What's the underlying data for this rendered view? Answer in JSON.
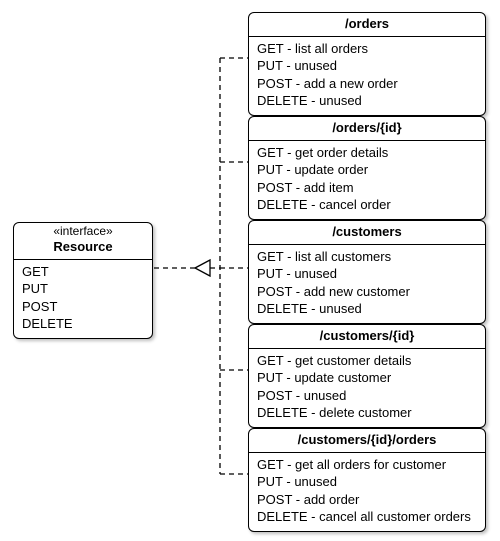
{
  "interface": {
    "stereotype": "«interface»",
    "name": "Resource",
    "methods": [
      "GET",
      "PUT",
      "POST",
      "DELETE"
    ]
  },
  "resources": [
    {
      "path": "/orders",
      "ops": [
        "GET - list all orders",
        "PUT - unused",
        "POST - add a new order",
        "DELETE -  unused"
      ]
    },
    {
      "path": "/orders/{id}",
      "ops": [
        "GET - get order details",
        "PUT - update order",
        "POST - add item",
        "DELETE - cancel order"
      ]
    },
    {
      "path": "/customers",
      "ops": [
        "GET - list all customers",
        "PUT - unused",
        "POST - add new customer",
        "DELETE - unused"
      ]
    },
    {
      "path": "/customers/{id}",
      "ops": [
        "GET - get customer details",
        "PUT - update customer",
        "POST - unused",
        "DELETE - delete customer"
      ]
    },
    {
      "path": "/customers/{id}/orders",
      "ops": [
        "GET - get all orders for customer",
        "PUT - unused",
        "POST - add order",
        "DELETE - cancel all customer orders"
      ]
    }
  ]
}
